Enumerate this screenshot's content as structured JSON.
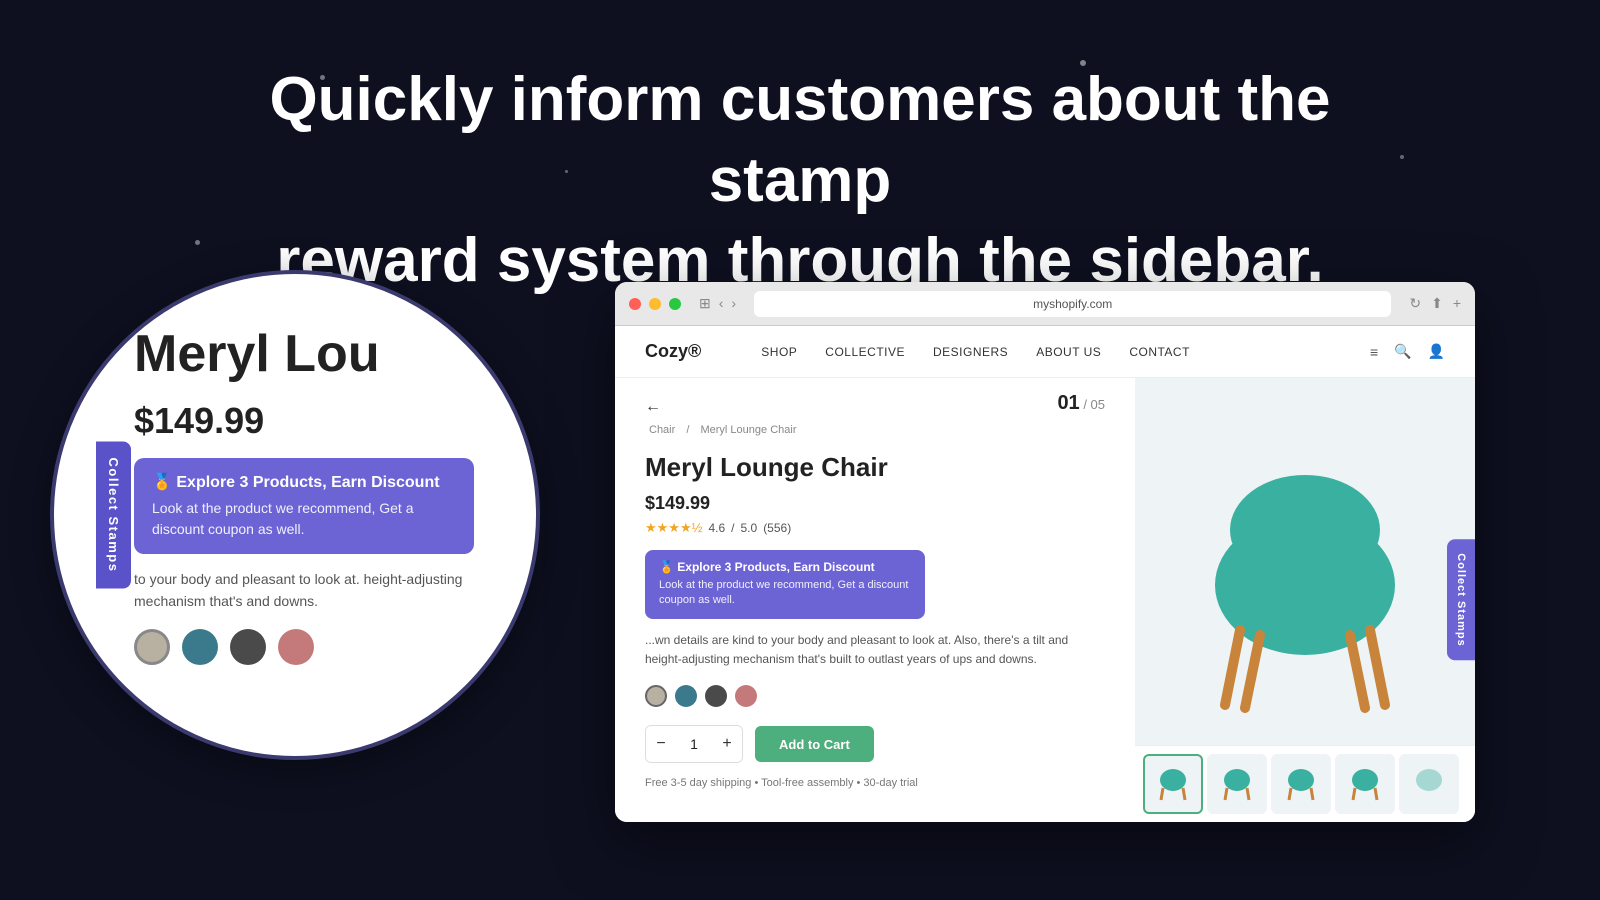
{
  "background": {
    "color": "#0e1020"
  },
  "hero": {
    "line1": "Quickly inform customers about the stamp",
    "line2": "reward system through the sidebar."
  },
  "browser": {
    "url": "myshopify.com",
    "page_indicator": "01 / 05"
  },
  "nav": {
    "logo": "Cozy®",
    "links": [
      "SHOP",
      "COLLECTIVE",
      "DESIGNERS",
      "ABOUT US",
      "CONTACT"
    ]
  },
  "breadcrumb": {
    "items": [
      "Chair",
      "Meryl Lounge Chair"
    ]
  },
  "product": {
    "title": "Meryl Lounge Chair",
    "price": "$149.99",
    "rating": "4.6",
    "review_count": "(556)",
    "rating_max": "5.0",
    "description": "...wn details are kind to your body and pleasant to look at. Also, there's a tilt and height-adjusting mechanism that's built to outlast years of ups and downs.",
    "quantity": "1",
    "add_to_cart_label": "Add to Cart",
    "shipping": "Free 3-5 day shipping  •  Tool-free assembly  •  30-day trial"
  },
  "stamp_popup": {
    "icon": "🏅",
    "title": "Explore 3 Products, Earn Discount",
    "text": "Look at the product we recommend, Get a discount coupon as well."
  },
  "stamp_sidebar": {
    "label": "Collect Stamps"
  },
  "color_swatches": [
    {
      "color": "#b8b0a0",
      "active": true
    },
    {
      "color": "#3a7a8c",
      "active": false
    },
    {
      "color": "#4a4a4a",
      "active": false
    },
    {
      "color": "#c47a7a",
      "active": false
    }
  ],
  "thumbnails": [
    {
      "label": "thumb-1",
      "active": true
    },
    {
      "label": "thumb-2",
      "active": false
    },
    {
      "label": "thumb-3",
      "active": false
    },
    {
      "label": "thumb-4",
      "active": false
    },
    {
      "label": "thumb-5",
      "active": false
    }
  ],
  "zoom": {
    "product_title": "Meryl Lou",
    "price": "$149.99",
    "popup_title": "Explore 3 Products, Earn Discount",
    "popup_text": "Look at the product we recommend, Get a discount coupon as well.",
    "description": "to your body and pleasant to look at. height-adjusting mechanism that's and downs."
  }
}
